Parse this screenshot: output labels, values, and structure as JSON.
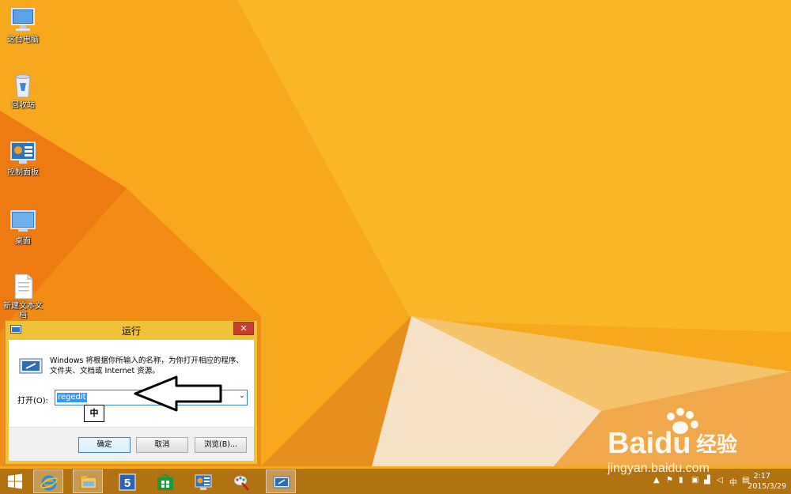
{
  "desktop": {
    "icons": [
      {
        "label": "这台电脑",
        "icon": "computer-icon"
      },
      {
        "label": "回收站",
        "icon": "recycle-bin-icon"
      },
      {
        "label": "控制面板",
        "icon": "control-panel-icon"
      },
      {
        "label": "桌面",
        "icon": "desktop-monitor-icon"
      },
      {
        "label": "新建文本文档",
        "icon": "text-document-icon"
      }
    ]
  },
  "run_dialog": {
    "title": "运行",
    "close_label": "✕",
    "description": "Windows 将根据你所输入的名称，为你打开相应的程序、文件夹、文档或 Internet 资源。",
    "open_label": "打开(O):",
    "input_value": "regedit",
    "dropdown_glyph": "⌄",
    "ime_indicator": "中",
    "buttons": {
      "ok": "确定",
      "cancel": "取消",
      "browse": "浏览(B)..."
    }
  },
  "taskbar": {
    "items": [
      {
        "icon": "start-windows-icon"
      },
      {
        "icon": "internet-explorer-icon"
      },
      {
        "icon": "file-explorer-icon"
      },
      {
        "icon": "app-5-icon"
      },
      {
        "icon": "store-icon"
      },
      {
        "icon": "control-panel-icon"
      },
      {
        "icon": "paint-tool-icon"
      },
      {
        "icon": "run-dialog-icon"
      }
    ],
    "tray": {
      "ime": "中",
      "time": "2:17",
      "date": "2015/3/29"
    }
  },
  "watermark": {
    "brand": "Baidu",
    "brand_cn": "经验",
    "url": "jingyan.baidu.com"
  },
  "colors": {
    "wallpaper": "#f6a21a",
    "wallpaper_light": "#f9c23a",
    "wallpaper_dark": "#e86f0c",
    "dialog_frame": "#f0c23a",
    "close_button": "#c7402f",
    "selection": "#3399ff"
  }
}
